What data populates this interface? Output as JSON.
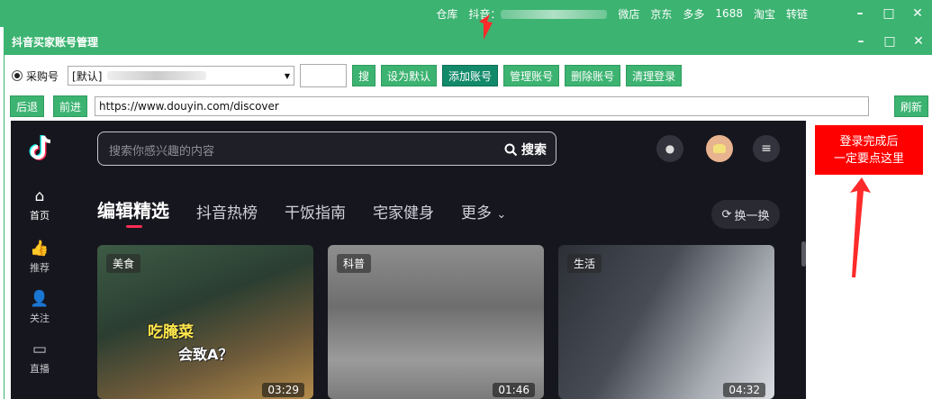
{
  "outer_bar": {
    "links": [
      "仓库",
      "抖音：",
      "微店",
      "京东",
      "多多",
      "1688",
      "淘宝",
      "转链"
    ],
    "controls": [
      "–",
      "□",
      "✕"
    ]
  },
  "window": {
    "title": "抖音买家账号管理",
    "controls": [
      "–",
      "□",
      "✕"
    ]
  },
  "toolbar": {
    "radio_label": "采购号",
    "account_select_value": "[默认]",
    "search_button": "搜",
    "set_default": "设为默认",
    "add_account": "添加账号",
    "manage_account": "管理账号",
    "delete_account": "删除账号",
    "clear_login": "清理登录"
  },
  "nav": {
    "back": "后退",
    "forward": "前进",
    "url": "https://www.douyin.com/discover",
    "refresh": "刷新"
  },
  "douyin": {
    "search_placeholder": "搜索你感兴趣的内容",
    "search_button": "搜索",
    "sidebar": [
      {
        "label": "首页",
        "icon": "home-icon",
        "glyph": "⌂"
      },
      {
        "label": "推荐",
        "icon": "thumbs-up-icon",
        "glyph": "👍"
      },
      {
        "label": "关注",
        "icon": "follow-user-icon",
        "glyph": "👤"
      },
      {
        "label": "直播",
        "icon": "live-tv-icon",
        "glyph": "▭"
      }
    ],
    "tabs": [
      "编辑精选",
      "抖音热榜",
      "干饭指南",
      "宅家健身",
      "更多"
    ],
    "more_chevron": "⌄",
    "refresh_pill": "换一换",
    "cards": [
      {
        "tag": "美食",
        "duration": "03:29",
        "caption1": "吃腌菜",
        "caption2": "会致A？"
      },
      {
        "tag": "科普",
        "duration": "01:46"
      },
      {
        "tag": "生活",
        "duration": "04:32"
      }
    ]
  },
  "annotation": {
    "line1": "登录完成后",
    "line2": "一定要点这里"
  },
  "colors": {
    "app_green": "#3cb371",
    "dark_teal": "#128a6a",
    "douyin_bg": "#16161e",
    "notice_red": "#ff0000",
    "tab_indicator": "#fe2c55"
  }
}
